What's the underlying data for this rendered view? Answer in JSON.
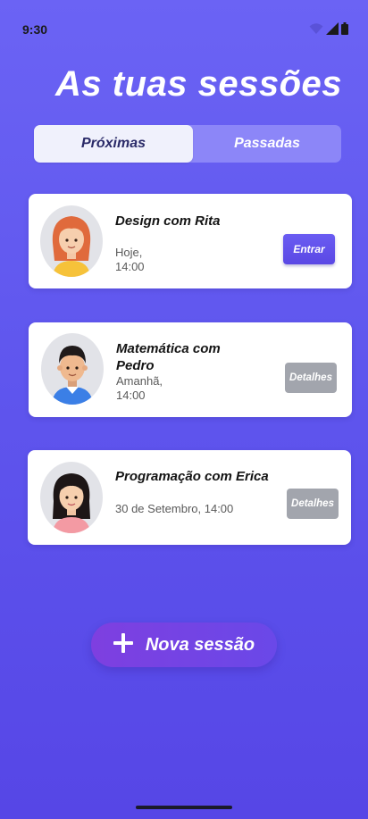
{
  "status_bar": {
    "time": "9:30",
    "icons": [
      "wifi-icon",
      "cellular-signal-icon",
      "battery-icon"
    ]
  },
  "title": "As tuas sessões",
  "tabs": [
    {
      "label": "Próximas",
      "active": true
    },
    {
      "label": "Passadas",
      "active": false
    }
  ],
  "sessions": [
    {
      "title": "Design com Rita",
      "time": "Hoje,\n14:00",
      "action": "Entrar",
      "avatar": "avatar-rita"
    },
    {
      "title": "Matemática com Pedro",
      "time": "Amanhã,\n14:00",
      "action": "Detalhes",
      "avatar": "avatar-pedro"
    },
    {
      "title": "Programação com Erica",
      "time": "30 de Setembro, 14:00",
      "action": "Detalhes",
      "avatar": "avatar-erica"
    }
  ],
  "new_session_button": {
    "label": "Nova sessão",
    "icon": "plus-icon"
  },
  "colors": {
    "background": "#5f56ee",
    "accent": "#5a48e4",
    "new_session": "#7e3fe0",
    "details_button": "#a2a5ad"
  }
}
